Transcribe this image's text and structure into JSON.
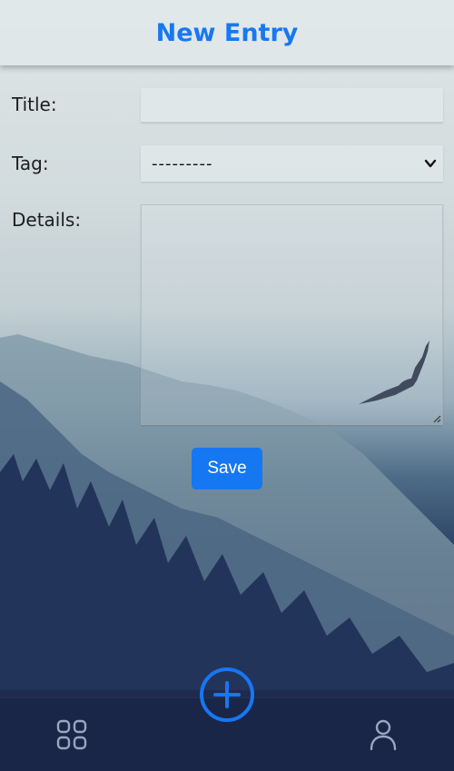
{
  "header": {
    "title": "New Entry"
  },
  "form": {
    "title_label": "Title:",
    "title_value": "",
    "tag_label": "Tag:",
    "tag_selected": "---------",
    "details_label": "Details:",
    "details_value": ""
  },
  "actions": {
    "save_label": "Save"
  },
  "nav": {
    "left_icon": "grid-icon",
    "center_icon": "plus-circle-icon",
    "right_icon": "user-icon"
  },
  "colors": {
    "accent": "#1677f2",
    "header_title": "#1878f0",
    "nav_icon": "#9aa6c2"
  }
}
